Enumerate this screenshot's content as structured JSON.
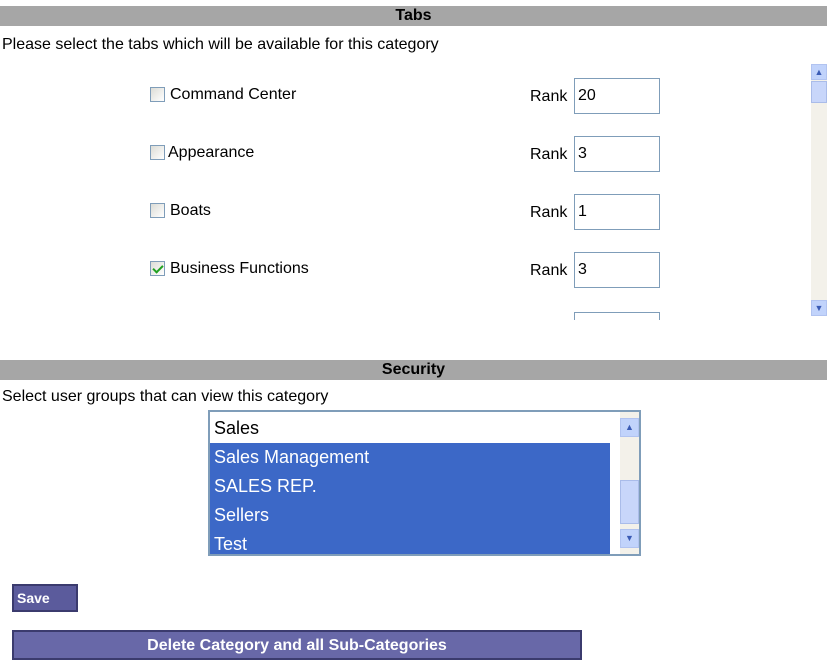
{
  "tabs_section": {
    "title": "Tabs",
    "description": "Please select the tabs which will be available for this category",
    "rank_label": "Rank",
    "items": [
      {
        "label": " Command Center",
        "checked": false,
        "rank": "20"
      },
      {
        "label": "Appearance",
        "checked": false,
        "rank": "3"
      },
      {
        "label": "Boats",
        "checked": false,
        "rank": "1"
      },
      {
        "label": "Business Functions",
        "checked": true,
        "rank": "3"
      }
    ]
  },
  "security_section": {
    "title": "Security",
    "description": "Select user groups that can view this category",
    "groups": [
      {
        "label": "Sales",
        "selected": false
      },
      {
        "label": "Sales Management",
        "selected": true
      },
      {
        "label": "SALES REP.",
        "selected": true
      },
      {
        "label": "Sellers",
        "selected": true
      },
      {
        "label": "Test",
        "selected": true
      }
    ]
  },
  "buttons": {
    "save": "Save",
    "delete": "Delete Category and all Sub-Categories"
  },
  "icons": {
    "scroll_up": "chevron-up-icon",
    "scroll_down": "chevron-down-icon",
    "checkmark": "checkmark-icon"
  }
}
